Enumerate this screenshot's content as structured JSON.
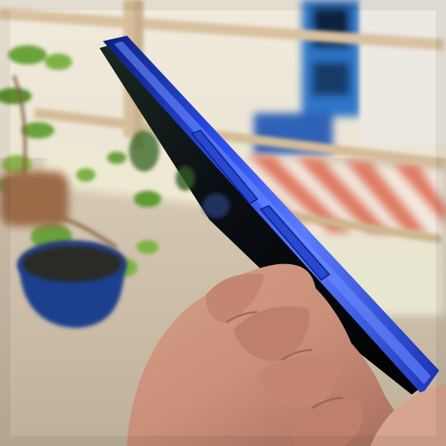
{
  "scene": {
    "subject": "side-view-of-blue-smartphone-held-in-hand",
    "colors": {
      "phone_blue": "#1f3fd6",
      "phone_highlight": "#5a7cff",
      "phone_shadow": "#0d1f7a",
      "screen_black": "#0b0e14",
      "skin": "#c98f78",
      "skin_shadow": "#8f5c4c",
      "wall": "#e9e3cf",
      "floor": "#cfc0a8",
      "railing": "#d8c1a0",
      "door_blue": "#2f74c8",
      "tile_red": "#e07b62",
      "tile_white": "#f3e9de",
      "pot_blue": "#1d3f8e",
      "leaf_green": "#6aa23a"
    },
    "icons": [
      "phone",
      "hand",
      "plant-pot",
      "railing",
      "door",
      "tiles"
    ]
  }
}
